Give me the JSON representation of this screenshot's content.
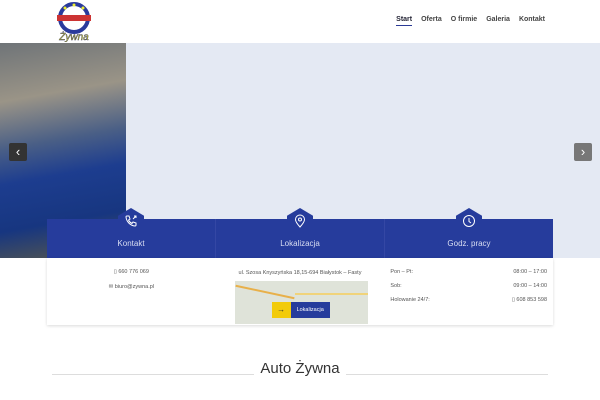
{
  "logo": {
    "text": "Żywna"
  },
  "nav": [
    "Start",
    "Oferta",
    "O firmie",
    "Galeria",
    "Kontakt"
  ],
  "slider": {
    "prev": "‹",
    "next": "›"
  },
  "boxes": [
    {
      "label": "Kontakt",
      "icon": "phone-icon"
    },
    {
      "label": "Lokalizacja",
      "icon": "map-pin-icon"
    },
    {
      "label": "Godz. pracy",
      "icon": "clock-icon"
    }
  ],
  "contact": {
    "phone": "660 776 069",
    "email": "biuro@zywna.pl"
  },
  "location": {
    "address": "ul. Szosa Knyszyńska 18,15-694 Białystok – Fasty",
    "button": "Lokalizacja",
    "arrow": "→"
  },
  "hours": [
    {
      "label": "Pon – Pt:",
      "value": "08:00 – 17:00"
    },
    {
      "label": "Sob:",
      "value": "09:00 – 14:00"
    },
    {
      "label": "Holowanie 24/7:",
      "value": "608 853 598"
    }
  ],
  "section_title": "Auto Żywna"
}
